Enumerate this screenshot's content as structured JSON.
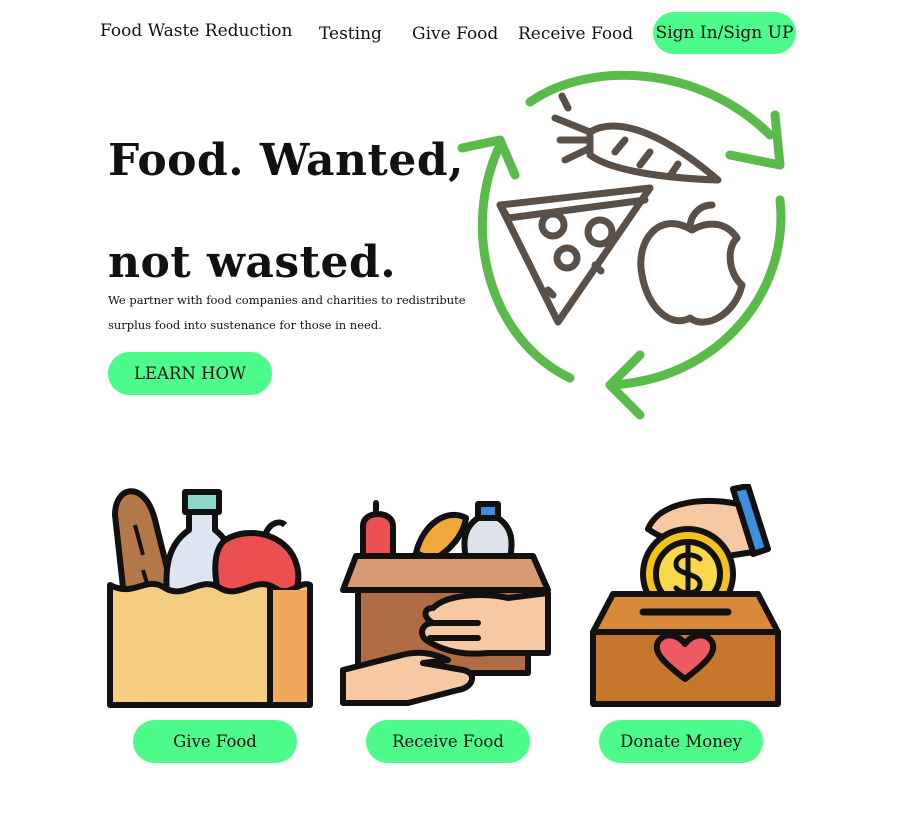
{
  "nav": {
    "brand": "Food Waste Reduction",
    "links": [
      "Testing",
      "Give Food",
      "Receive Food"
    ],
    "signin": "Sign In/Sign UP"
  },
  "hero": {
    "line1": "Food. Wanted,",
    "line2": "not wasted.",
    "sub1": "We partner with food companies and charities to redistribute",
    "sub2": "surplus food into sustenance for those in need.",
    "cta": "LEARN HOW"
  },
  "illustrations": {
    "recycle": "recycle-food-icon",
    "give": "grocery-bag-icon",
    "receive": "donation-box-hands-icon",
    "donate": "coin-donation-box-icon"
  },
  "features": {
    "give": "Give Food",
    "receive": "Receive Food",
    "donate": "Donate Money"
  },
  "colors": {
    "accent": "#4dfb8a",
    "recycle_green": "#5bbb4a",
    "outline": "#5a5048"
  }
}
